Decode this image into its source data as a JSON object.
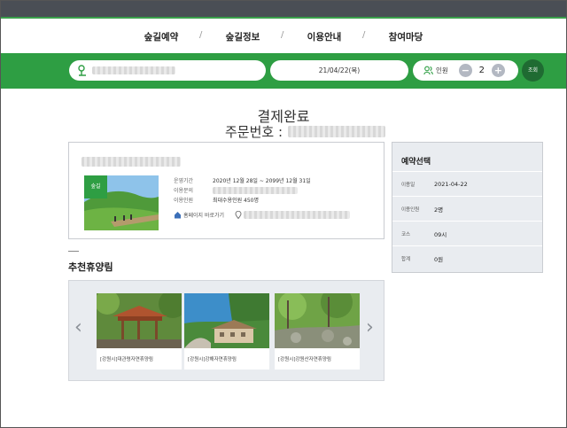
{
  "nav": {
    "items": [
      "숲길예약",
      "숲길정보",
      "이용안내",
      "참여마당"
    ],
    "separator": "/"
  },
  "search": {
    "date_value": "21/04/22(목)",
    "people_label": "인원",
    "people_count": "2",
    "minus_label": "−",
    "plus_label": "+",
    "search_button": "조회"
  },
  "page": {
    "title": "결제완료",
    "order_label": "주문번호 :"
  },
  "facility": {
    "badge": "숲길",
    "period_label": "운영기간",
    "period_value": "2020년 12월 28일 ~ 2099년 12월 31일",
    "contact_label": "이용문의",
    "capacity_label": "이용인원",
    "capacity_value": "최대수용인원 450명",
    "homepage_link": "홈페이지 바로가기"
  },
  "summary": {
    "title": "예약선택",
    "rows": [
      {
        "label": "이용일",
        "value": "2021-04-22"
      },
      {
        "label": "이용인원",
        "value": "2명"
      },
      {
        "label": "코스",
        "value": "09시"
      },
      {
        "label": "합계",
        "value": "0원"
      }
    ]
  },
  "recommend": {
    "title": "추천휴양림",
    "prev": "‹",
    "next": "›",
    "items": [
      {
        "label": "[강원시]대관령자연휴양림"
      },
      {
        "label": "[강원시]강해자연휴양림"
      },
      {
        "label": "[강원시]강원산자연휴양림"
      }
    ]
  },
  "colors": {
    "brand_green": "#2e9e43",
    "dark_green": "#1f6b32",
    "topbar": "#4a4e55",
    "panel_gray": "#e9ecf0"
  }
}
